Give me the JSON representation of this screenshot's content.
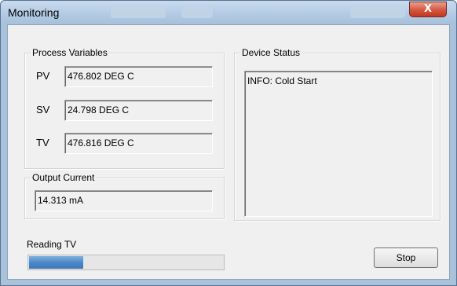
{
  "window": {
    "title": "Monitoring",
    "close_glyph": "X",
    "close_icon": "close-icon"
  },
  "process_variables": {
    "label": "Process Variables",
    "rows": [
      {
        "name": "PV",
        "value": "476.802 DEG C"
      },
      {
        "name": "SV",
        "value": "24.798 DEG C"
      },
      {
        "name": "TV",
        "value": "476.816 DEG C"
      }
    ]
  },
  "output_current": {
    "label": "Output Current",
    "value": "14.313 mA"
  },
  "device_status": {
    "label": "Device Status",
    "text": "INFO: Cold Start"
  },
  "progress": {
    "label": "Reading TV",
    "fraction": 0.28,
    "color": "#4a86c8"
  },
  "stop_button": {
    "label": "Stop"
  }
}
